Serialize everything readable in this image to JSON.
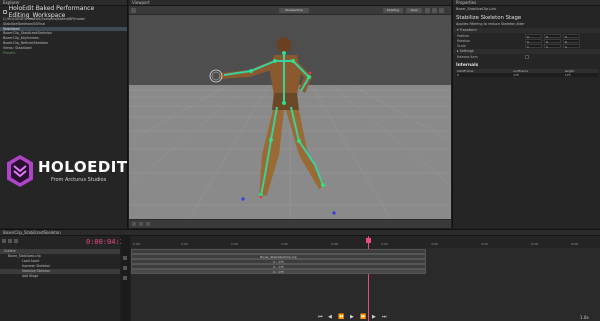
{
  "explorer": {
    "panel_title": "Explorer",
    "title": "HoloEdit Baked Performance Editing_Workspace",
    "items": [
      {
        "label": "C:/HOLOEDIT/HoloEdit/Samples/Baked/BP/model",
        "state": "normal"
      },
      {
        "label": "StabilizeSkeleton/SSFinal",
        "state": "normal"
      },
      {
        "label": "Stabilized",
        "state": "selected"
      },
      {
        "label": "BoxerClip_StabilizedSkeleton",
        "state": "normal"
      },
      {
        "label": "BoxerClip_Keyframes",
        "state": "normal"
      },
      {
        "label": "BoxerClip_RefinedSkeleton",
        "state": "normal"
      },
      {
        "label": "Views: Stabilized",
        "state": "normal"
      },
      {
        "label": "Presets",
        "state": "dim"
      }
    ],
    "logo_text": "HOLOEDIT",
    "logo_sub": "From Arcturus Studios"
  },
  "viewport": {
    "panel_title": "Viewport",
    "camera_label": "Perspective",
    "shading_label": "Shading",
    "view_label": "View"
  },
  "properties": {
    "panel_title": "Properties",
    "breadcrumb": "Boxer_StabilizeClip.Link",
    "stage_title": "Stabilize Skeleton Stage",
    "stage_desc": "Applies filtering to reduce Skeleton jitter",
    "transform_label": "Transform",
    "rows": [
      {
        "label": "Position",
        "values": [
          "0",
          "0",
          "0"
        ]
      },
      {
        "label": "Rotation",
        "values": [
          "0",
          "0",
          "0"
        ]
      },
      {
        "label": "Scale",
        "values": [
          "1",
          "1",
          "1"
        ]
      }
    ],
    "settings_label": "Settings",
    "release_label": "Release Item",
    "internals_label": "Internals",
    "internals_headers": [
      "startFrame",
      "endFrame",
      "length"
    ],
    "internals_values": [
      "0",
      "175",
      "175"
    ]
  },
  "timeline": {
    "panel_title": "BoxerClip_StabilizedSkeleton",
    "timecode": "0:00:04:22",
    "tracks": [
      {
        "label": "Outline",
        "hl": true
      },
      {
        "label": "Boxer_Stabilized.clip",
        "hl": false
      },
      {
        "label": "Load Asset",
        "hl": false
      },
      {
        "label": "Isomesh Skeleton",
        "hl": false
      },
      {
        "label": "Stabilize Skeleton",
        "hl": true
      },
      {
        "label": "Add Stage",
        "hl": false
      }
    ],
    "clip_label": "Boxer_StabilizedClip.clip",
    "ranges": [
      "0 - 175",
      "0 - 175",
      "0 - 175"
    ],
    "ruler": [
      "0:00",
      "0:40",
      "1:20",
      "2:00",
      "2:40",
      "3:20",
      "4:00",
      "4:40",
      "5:20",
      "6:00",
      "6:40",
      "7:20"
    ],
    "speed": "1.0x"
  }
}
